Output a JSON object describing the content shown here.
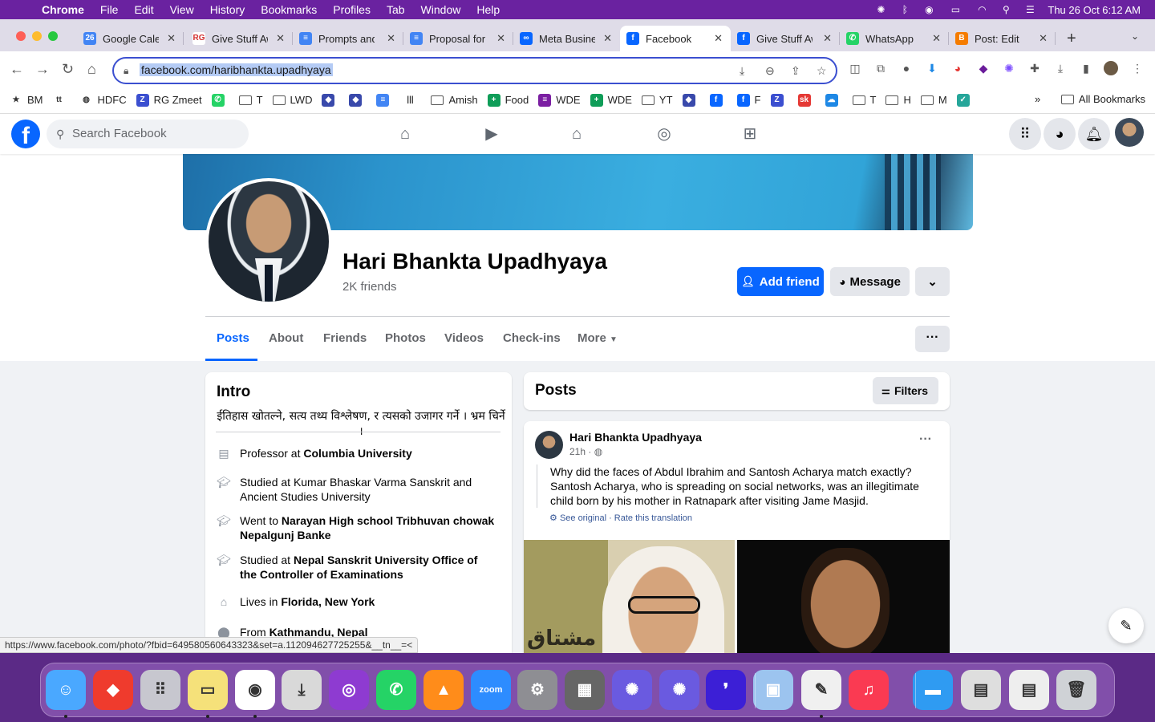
{
  "menubar": {
    "app": "Chrome",
    "items": [
      "File",
      "Edit",
      "View",
      "History",
      "Bookmarks",
      "Profiles",
      "Tab",
      "Window",
      "Help"
    ],
    "datetime": "Thu 26 Oct  6:12 AM"
  },
  "tabs": [
    {
      "title": "Google Calendar",
      "fav_text": "26",
      "color": "#4285f4"
    },
    {
      "title": "Give Stuff Away",
      "fav_text": "RG",
      "color": "#ffffff"
    },
    {
      "title": "Prompts and",
      "fav_text": "≡",
      "color": "#4285f4"
    },
    {
      "title": "Proposal for",
      "fav_text": "≡",
      "color": "#4285f4"
    },
    {
      "title": "Meta Business",
      "fav_text": "∞",
      "color": "#0866ff"
    },
    {
      "title": "Facebook",
      "fav_text": "f",
      "color": "#0866ff"
    },
    {
      "title": "Give Stuff Away",
      "fav_text": "f",
      "color": "#0866ff"
    },
    {
      "title": "WhatsApp",
      "fav_text": "✆",
      "color": "#25d366"
    },
    {
      "title": "Post: Edit",
      "fav_text": "B",
      "color": "#f57c00"
    }
  ],
  "omnibox": {
    "url": "facebook.com/haribhankta.upadhyaya"
  },
  "bookmarks": [
    {
      "label": "BM",
      "icon": "star-icon"
    },
    {
      "label": "",
      "icon": "ttdv-icon",
      "text": "tt"
    },
    {
      "label": "HDFC",
      "icon": "globe-icon"
    },
    {
      "label": "RG Zmeet",
      "icon": "z-icon"
    },
    {
      "label": "",
      "icon": "whatsapp-icon"
    },
    {
      "label": "T",
      "icon": "folder-icon"
    },
    {
      "label": "LWD",
      "icon": "folder-icon"
    },
    {
      "label": "",
      "icon": "app-icon"
    },
    {
      "label": "",
      "icon": "app-icon"
    },
    {
      "label": "",
      "icon": "docs-icon"
    },
    {
      "label": "",
      "icon": "barcode-icon"
    },
    {
      "label": "Amish",
      "icon": "folder-icon"
    },
    {
      "label": "Food",
      "icon": "sheets-icon"
    },
    {
      "label": "WDE",
      "icon": "forms-icon"
    },
    {
      "label": "WDE",
      "icon": "sheets-icon"
    },
    {
      "label": "YT",
      "icon": "folder-icon"
    },
    {
      "label": "",
      "icon": "app-icon"
    },
    {
      "label": "",
      "icon": "facebook-icon"
    },
    {
      "label": "F",
      "icon": "facebook-icon"
    },
    {
      "label": "",
      "icon": "z-icon"
    },
    {
      "label": "",
      "icon": "sk-icon",
      "text": "sk"
    },
    {
      "label": "",
      "icon": "cloud-icon"
    },
    {
      "label": "T",
      "icon": "folder-icon"
    },
    {
      "label": "H",
      "icon": "folder-icon"
    },
    {
      "label": "M",
      "icon": "folder-icon"
    },
    {
      "label": "",
      "icon": "check-icon"
    }
  ],
  "all_bookmarks": "All Bookmarks",
  "fb": {
    "search_placeholder": "Search Facebook",
    "profile": {
      "name": "Hari Bhankta Upadhyaya",
      "friends": "2K friends",
      "add_friend": "Add friend",
      "message": "Message"
    },
    "tabs": [
      "Posts",
      "About",
      "Friends",
      "Photos",
      "Videos",
      "Check-ins",
      "More"
    ],
    "intro": {
      "title": "Intro",
      "bio": "ईतिहास खोतल्ने, सत्य तथ्य विश्लेषण, र त्यसको उजागर गर्ने । भ्रम चिर्ने ।",
      "items": [
        {
          "prefix": "Professor at ",
          "bold": "Columbia University",
          "icon": "briefcase-icon"
        },
        {
          "prefix": "Studied at Kumar Bhaskar Varma Sanskrit and Ancient Studies University",
          "bold": "",
          "icon": "graduation-cap-icon"
        },
        {
          "prefix": "Went to ",
          "bold": "Narayan High school Tribhuvan chowak Nepalgunj Banke",
          "icon": "graduation-cap-icon"
        },
        {
          "prefix": "Studied at ",
          "bold": "Nepal Sanskrit University Office of the Controller of Examinations",
          "icon": "graduation-cap-icon"
        },
        {
          "prefix": "Lives in ",
          "bold": "Florida, New York",
          "icon": "home-icon"
        },
        {
          "prefix": "From ",
          "bold": "Kathmandu, Nepal",
          "icon": "location-pin-icon"
        }
      ]
    },
    "posts_title": "Posts",
    "filters": "Filters",
    "post": {
      "author": "Hari Bhankta Upadhyaya",
      "time": "21h · ",
      "text": "Why did the faces of Abdul Ibrahim and Santosh Acharya match exactly? Santosh Acharya, who is spreading on social networks, was an illegitimate child born by his mother in Ratnapark after visiting Jame Masjid.",
      "translation": "See original · Rate this translation",
      "image_text": "مشتاق"
    }
  },
  "status_url": "https://www.facebook.com/photo/?fbid=649580560643323&set=a.112094627725255&__tn__=<",
  "dock": [
    "Finder",
    "AnyDesk",
    "Launchpad",
    "Notes",
    "Chrome",
    "Downloader",
    "Podcasts",
    "WhatsApp",
    "VLC",
    "Zoom",
    "System Settings",
    "Calculator",
    "App",
    "App",
    "App",
    "Preview",
    "TextEdit",
    "Music",
    "Folder",
    "Files",
    "Document",
    "Trash"
  ]
}
